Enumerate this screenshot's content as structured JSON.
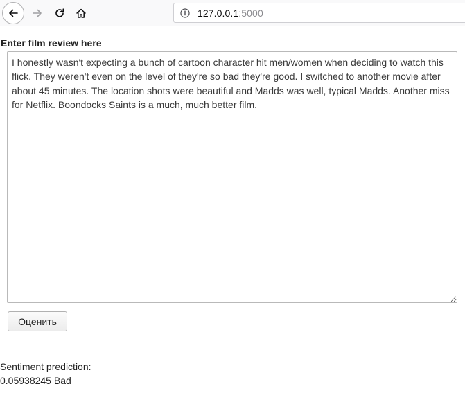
{
  "browser": {
    "url_host": "127.0.0.1",
    "url_port": ":5000",
    "icons": {
      "back": "back-arrow-icon",
      "forward": "forward-arrow-icon",
      "reload": "reload-icon",
      "home": "home-icon",
      "info": "info-icon"
    }
  },
  "form": {
    "label": "Enter film review here",
    "review_text": "I honestly wasn't expecting a bunch of cartoon character hit men/women when deciding to watch this flick. They weren't even on the level of they're so bad they're good. I switched to another movie after about 45 minutes. The location shots were beautiful and Madds was well, typical Madds. Another miss for Netflix. Boondocks Saints is a much, much better film.",
    "submit_label": "Оценить"
  },
  "result": {
    "label": "Sentiment prediction:",
    "score": "0.05938245",
    "verdict": "Bad"
  }
}
